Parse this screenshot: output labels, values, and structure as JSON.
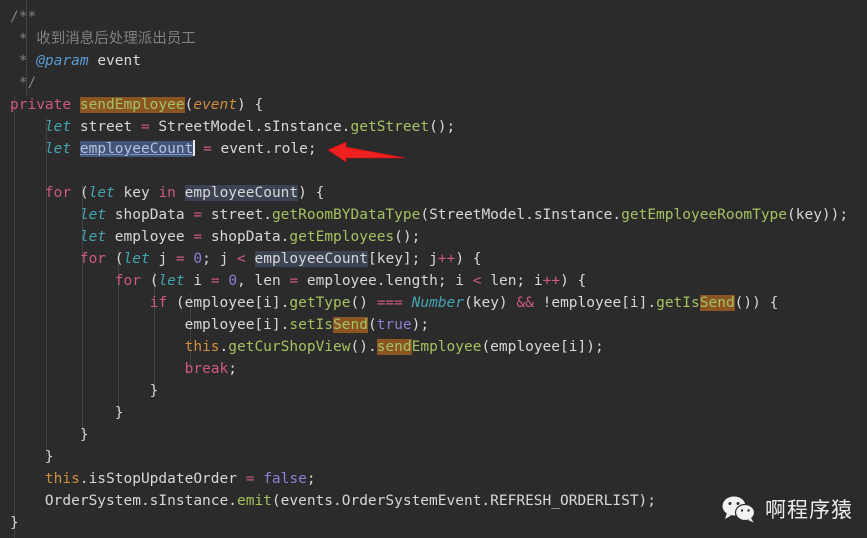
{
  "editor": {
    "language": "typescript",
    "background_color": "#2b2b2b",
    "selected_text": "employeeCount",
    "occurrence_highlight_text": "employeeCount",
    "search_highlight_text": "Send"
  },
  "colors": {
    "background": "#2b2b2b",
    "comment": "#7f8185",
    "keyword": "#cc5a7c",
    "keyword_italic": "#44a4b0",
    "function": "#a5c261",
    "text": "#d7d7d7",
    "number": "#8f7fd6",
    "parameter": "#cf8e3f",
    "doc_tag": "#5b9bd5",
    "search_match_bg": "#8a5423",
    "occurrence_bg": "#3c4454",
    "selection_bg": "#41557a",
    "indent_guide": "#4a4a4a",
    "arrow": "#ee2020"
  },
  "code": {
    "line01_c1": "/**",
    "line02_c1": " * ",
    "line02_c2": "收到消息后处理派出员工",
    "line03_c1": " * ",
    "line03_c2": "@param",
    "line03_c3": " event",
    "line04_c1": " */",
    "line05_c1": "private",
    "line05_c2": " ",
    "line05_c3": "sendEmployee",
    "line05_c4": "(",
    "line05_c5": "event",
    "line05_c6": ") {",
    "line06_c1": "    ",
    "line06_c2": "let",
    "line06_c3": " street ",
    "line06_c4": "=",
    "line06_c5": " StreetModel.sInstance.",
    "line06_c6": "getStreet",
    "line06_c7": "();",
    "line07_c1": "    ",
    "line07_c2": "let",
    "line07_c3": " ",
    "line07_c4": "employeeCount",
    "line07_c5": " ",
    "line07_c6": "=",
    "line07_c7": " event.role;",
    "line08_c1": "",
    "line09_c1": "    ",
    "line09_c2": "for",
    "line09_c3": " (",
    "line09_c4": "let",
    "line09_c5": " key ",
    "line09_c6": "in",
    "line09_c7": " ",
    "line09_c8": "employeeCount",
    "line09_c9": ") {",
    "line10_c1": "        ",
    "line10_c2": "let",
    "line10_c3": " shopData ",
    "line10_c4": "=",
    "line10_c5": " street.",
    "line10_c6": "getRoomBYDataType",
    "line10_c7": "(StreetModel.sInstance.",
    "line10_c8": "getEmployeeRoomType",
    "line10_c9": "(key));",
    "line11_c1": "        ",
    "line11_c2": "let",
    "line11_c3": " employee ",
    "line11_c4": "=",
    "line11_c5": " shopData.",
    "line11_c6": "getEmployees",
    "line11_c7": "();",
    "line12_c1": "        ",
    "line12_c2": "for",
    "line12_c3": " (",
    "line12_c4": "let",
    "line12_c5": " j ",
    "line12_c6": "=",
    "line12_c7": " ",
    "line12_c8": "0",
    "line12_c9": "; j ",
    "line12_c10": "<",
    "line12_c11": " ",
    "line12_c12": "employeeCount",
    "line12_c13": "[key]; j",
    "line12_c14": "++",
    "line12_c15": ") {",
    "line13_c1": "            ",
    "line13_c2": "for",
    "line13_c3": " (",
    "line13_c4": "let",
    "line13_c5": " i ",
    "line13_c6": "=",
    "line13_c7": " ",
    "line13_c8": "0",
    "line13_c9": ", len ",
    "line13_c10": "=",
    "line13_c11": " employee.length; i ",
    "line13_c12": "<",
    "line13_c13": " len; i",
    "line13_c14": "++",
    "line13_c15": ") {",
    "line14_c1": "                ",
    "line14_c2": "if",
    "line14_c3": " (employee[i].",
    "line14_c4": "getType",
    "line14_c5": "() ",
    "line14_c6": "===",
    "line14_c7": " ",
    "line14_c8": "Number",
    "line14_c9": "(key) ",
    "line14_c10": "&&",
    "line14_c11": " !employee[i].",
    "line14_c12": "getIs",
    "line14_c13": "Send",
    "line14_c14": "()) {",
    "line15_c1": "                    employee[i].",
    "line15_c2": "setIs",
    "line15_c3": "Send",
    "line15_c4": "(",
    "line15_c5": "true",
    "line15_c6": ");",
    "line16_c1": "                    ",
    "line16_c2": "this",
    "line16_c3": ".",
    "line16_c4": "getCurShopView",
    "line16_c5": "().",
    "line16_c6": "send",
    "line16_c7": "Employee",
    "line16_c8": "(employee[i]);",
    "line17_c1": "                    ",
    "line17_c2": "break",
    "line17_c3": ";",
    "line18_c1": "                }",
    "line19_c1": "            }",
    "line20_c1": "        }",
    "line21_c1": "    }",
    "line22_c1": "    ",
    "line22_c2": "this",
    "line22_c3": ".isStopUpdateOrder ",
    "line22_c4": "=",
    "line22_c5": " ",
    "line22_c6": "false",
    "line22_c7": ";",
    "line23_c1": "    OrderSystem.sInstance.",
    "line23_c2": "emit",
    "line23_c3": "(events.OrderSystemEvent.REFRESH_ORDERLIST);",
    "line24_c1": "}"
  },
  "watermark": {
    "icon": "wechat-icon",
    "text": "啊程序猿"
  },
  "annotation": {
    "arrow": "red-arrow-pointing-left",
    "points_at": "employeeCount = event.role;"
  }
}
